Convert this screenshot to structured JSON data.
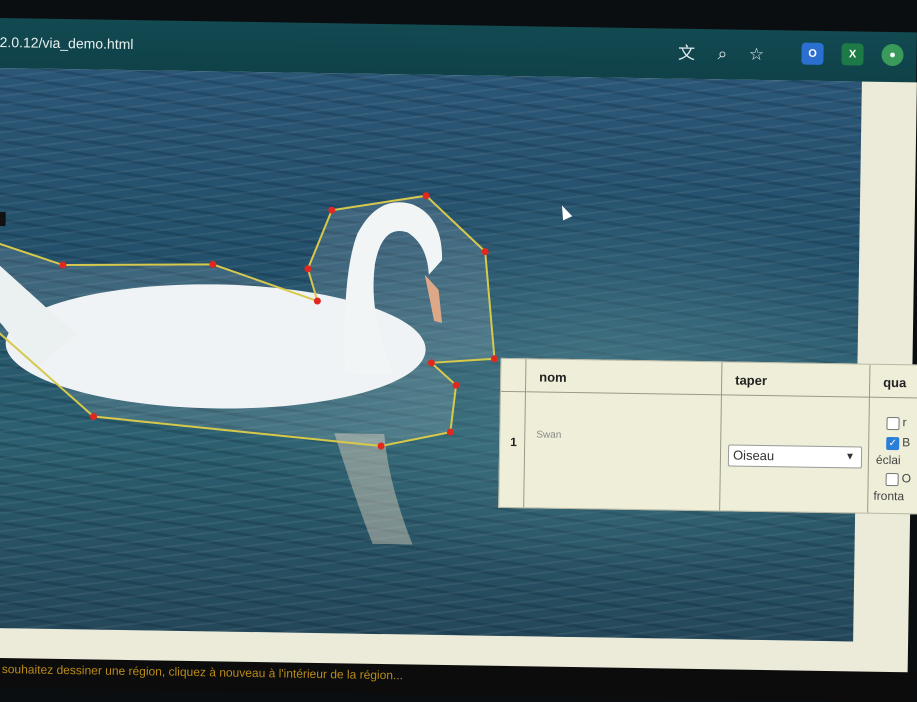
{
  "browser": {
    "url": "2.0.12/via_demo.html",
    "icons": [
      "translate-icon",
      "zoom-icon",
      "star-icon"
    ],
    "extensions": [
      "extension-outlook-icon",
      "extension-excel-icon",
      "extension-misc-icon"
    ]
  },
  "annotation_table": {
    "headers": [
      "nom",
      "taper",
      "qua"
    ],
    "row": {
      "index": "1",
      "nom": "Swan",
      "taper": "Oiseau",
      "quality_options": [
        {
          "label": "r",
          "checked": false
        },
        {
          "label": "B",
          "checked": true
        },
        {
          "label": "éclai",
          "checked": null
        },
        {
          "label": "O",
          "checked": false
        },
        {
          "label": "fronta",
          "checked": null
        }
      ]
    }
  },
  "status_message": "souhaitez dessiner une région, cliquez à nouveau à l'intérieur de la région..."
}
